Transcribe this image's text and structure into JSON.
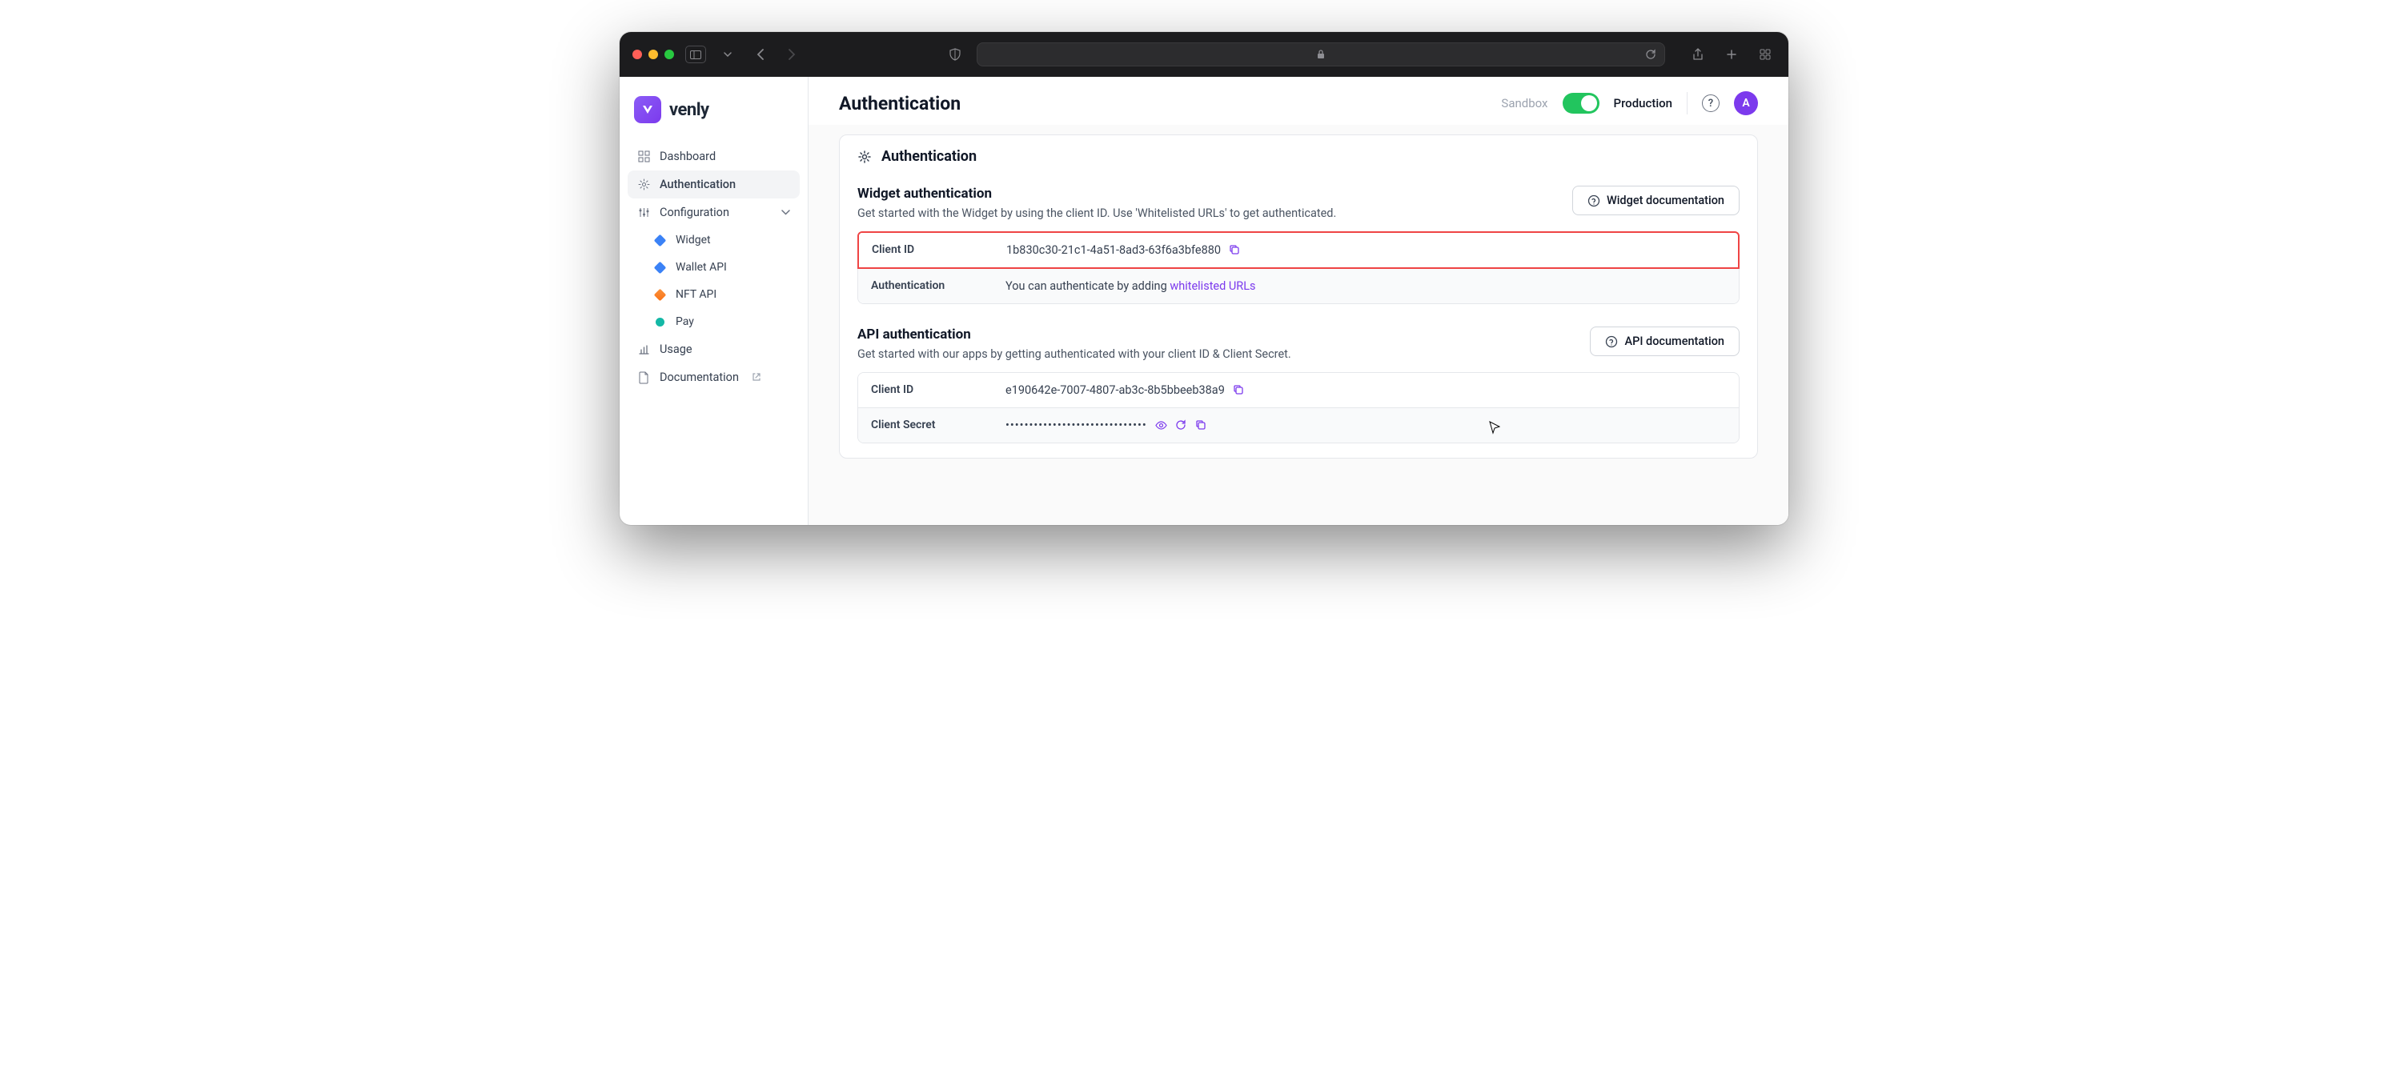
{
  "brand": "venly",
  "page_title": "Authentication",
  "env": {
    "left": "Sandbox",
    "right": "Production"
  },
  "avatar_initial": "A",
  "sidebar": {
    "items": [
      {
        "label": "Dashboard"
      },
      {
        "label": "Authentication"
      },
      {
        "label": "Configuration"
      },
      {
        "label": "Widget"
      },
      {
        "label": "Wallet API"
      },
      {
        "label": "NFT API"
      },
      {
        "label": "Pay"
      },
      {
        "label": "Usage"
      },
      {
        "label": "Documentation"
      }
    ]
  },
  "card_title": "Authentication",
  "widget_section": {
    "title": "Widget authentication",
    "desc": "Get started with the Widget by using the client ID. Use 'Whitelisted URLs' to get authenticated.",
    "doc_btn": "Widget documentation",
    "rows": {
      "client_id_label": "Client ID",
      "client_id_value": "1b830c30-21c1-4a51-8ad3-63f6a3bfe880",
      "auth_label": "Authentication",
      "auth_text_pre": "You can authenticate by adding ",
      "auth_link": "whitelisted URLs"
    }
  },
  "api_section": {
    "title": "API authentication",
    "desc": "Get started with our apps by getting authenticated with your client ID & Client Secret.",
    "doc_btn": "API documentation",
    "rows": {
      "client_id_label": "Client ID",
      "client_id_value": "e190642e-7007-4807-ab3c-8b5bbeeb38a9",
      "secret_label": "Client Secret",
      "secret_value": "••••••••••••••••••••••••••••••"
    }
  }
}
